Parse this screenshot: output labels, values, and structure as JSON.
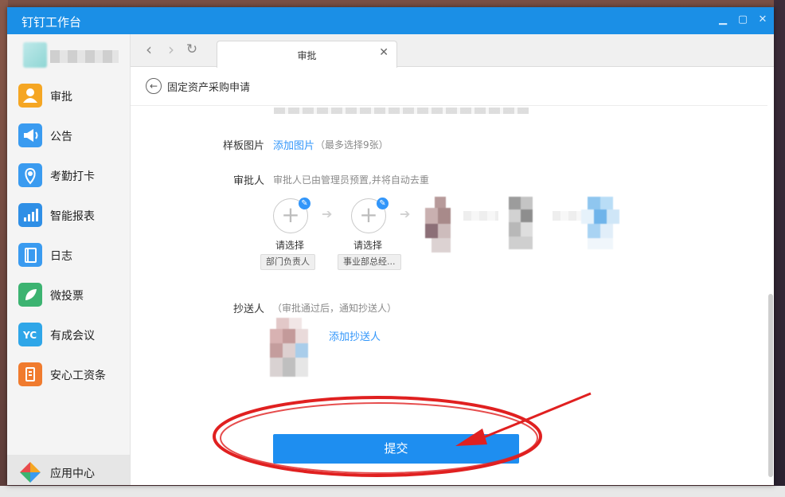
{
  "window": {
    "title": "钉钉工作台"
  },
  "sidebar": {
    "items": [
      {
        "label": "审批",
        "icon": "person-icon",
        "color": "#f5a623"
      },
      {
        "label": "公告",
        "icon": "megaphone-icon",
        "color": "#3a9bf0"
      },
      {
        "label": "考勤打卡",
        "icon": "location-icon",
        "color": "#3a9bf0"
      },
      {
        "label": "智能报表",
        "icon": "chart-icon",
        "color": "#2f8fe6"
      },
      {
        "label": "日志",
        "icon": "notebook-icon",
        "color": "#3a9bf0"
      },
      {
        "label": "微投票",
        "icon": "leaf-icon",
        "color": "#3cb371"
      },
      {
        "label": "有成会议",
        "icon": "meeting-icon",
        "color": "#2fa6e8"
      },
      {
        "label": "安心工资条",
        "icon": "salary-icon",
        "color": "#f07b2e"
      }
    ],
    "bottom": {
      "label": "应用中心",
      "icon": "app-center-icon"
    }
  },
  "tab": {
    "label": "审批"
  },
  "page": {
    "title": "固定资产采购申请"
  },
  "form": {
    "template_image": {
      "label": "样板图片",
      "link": "添加图片",
      "hint": "（最多选择9张）"
    },
    "approver": {
      "label": "审批人",
      "hint": "审批人已由管理员预置,并将自动去重",
      "steps": [
        {
          "label": "请选择",
          "tag": "部门负责人"
        },
        {
          "label": "请选择",
          "tag": "事业部总经..."
        }
      ]
    },
    "cc": {
      "label": "抄送人",
      "hint": "（审批通过后，通知抄送人）",
      "link": "添加抄送人"
    },
    "submit_label": "提交"
  },
  "colors": {
    "accent": "#1e8ef0",
    "annotation": "#e02020"
  }
}
